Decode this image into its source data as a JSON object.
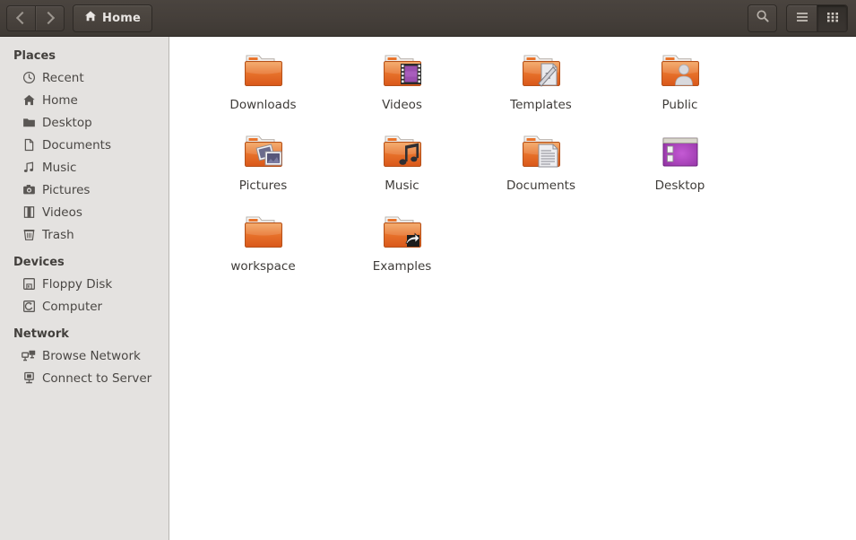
{
  "header": {
    "back_label": "Back",
    "forward_label": "Forward",
    "path_label": "Home",
    "path_icon": "home-icon",
    "search_label": "Search",
    "search_icon": "search-icon",
    "list_view_label": "List view",
    "list_view_icon": "list-view-icon",
    "grid_view_label": "Icon view",
    "grid_view_icon": "grid-view-icon",
    "active_view": "grid",
    "bg_color": "#453f3a",
    "text_color": "#e8e5e2"
  },
  "sidebar": {
    "bg_color": "#e4e2e0",
    "sections": [
      {
        "title": "Places",
        "items": [
          {
            "label": "Recent",
            "icon": "clock-icon"
          },
          {
            "label": "Home",
            "icon": "home-icon"
          },
          {
            "label": "Desktop",
            "icon": "folder-icon"
          },
          {
            "label": "Documents",
            "icon": "document-icon"
          },
          {
            "label": "Music",
            "icon": "music-note-icon"
          },
          {
            "label": "Pictures",
            "icon": "camera-icon"
          },
          {
            "label": "Videos",
            "icon": "film-icon"
          },
          {
            "label": "Trash",
            "icon": "trash-icon"
          }
        ]
      },
      {
        "title": "Devices",
        "items": [
          {
            "label": "Floppy Disk",
            "icon": "floppy-icon"
          },
          {
            "label": "Computer",
            "icon": "computer-icon"
          }
        ]
      },
      {
        "title": "Network",
        "items": [
          {
            "label": "Browse Network",
            "icon": "network-icon"
          },
          {
            "label": "Connect to Server",
            "icon": "server-icon"
          }
        ]
      }
    ]
  },
  "main": {
    "bg_color": "#ffffff",
    "folder_color": "#e8732c",
    "items": [
      {
        "label": "Downloads",
        "icon": "folder-icon",
        "emblem": "none"
      },
      {
        "label": "Videos",
        "icon": "folder-videos-icon",
        "emblem": "film-strip"
      },
      {
        "label": "Templates",
        "icon": "folder-templates-icon",
        "emblem": "template-page"
      },
      {
        "label": "Public",
        "icon": "folder-public-icon",
        "emblem": "person"
      },
      {
        "label": "Pictures",
        "icon": "folder-pictures-icon",
        "emblem": "photos"
      },
      {
        "label": "Music",
        "icon": "folder-music-icon",
        "emblem": "music-note"
      },
      {
        "label": "Documents",
        "icon": "folder-documents-icon",
        "emblem": "text-page"
      },
      {
        "label": "Desktop",
        "icon": "desktop-window-icon",
        "emblem": "none"
      },
      {
        "label": "workspace",
        "icon": "folder-icon",
        "emblem": "none"
      },
      {
        "label": "Examples",
        "icon": "folder-symlink-icon",
        "emblem": "symlink-arrow"
      }
    ]
  }
}
